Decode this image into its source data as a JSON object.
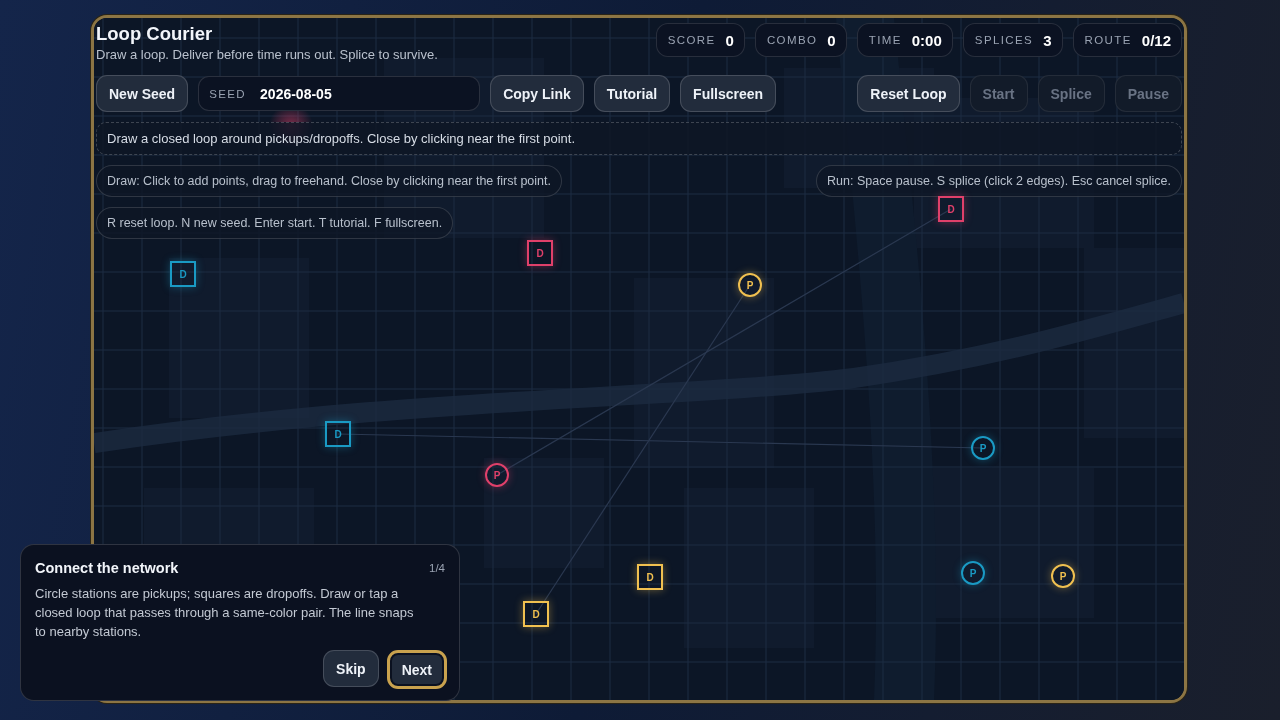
{
  "header": {
    "title": "Loop Courier",
    "subtitle": "Draw a loop. Deliver before time runs out. Splice to survive."
  },
  "stats": [
    {
      "label": "SCORE",
      "value": "0"
    },
    {
      "label": "COMBO",
      "value": "0"
    },
    {
      "label": "TIME",
      "value": "0:00"
    },
    {
      "label": "SPLICES",
      "value": "3"
    },
    {
      "label": "ROUTE",
      "value": "0/12"
    }
  ],
  "toolbar_left": [
    {
      "kind": "button",
      "label": "New Seed",
      "disabled": false
    },
    {
      "kind": "field",
      "label": "SEED",
      "value": "2026-08-05"
    },
    {
      "kind": "button",
      "label": "Copy Link",
      "disabled": false
    },
    {
      "kind": "button",
      "label": "Tutorial",
      "disabled": false
    },
    {
      "kind": "button",
      "label": "Fullscreen",
      "disabled": false
    }
  ],
  "toolbar_right": [
    {
      "label": "Reset Loop",
      "disabled": false
    },
    {
      "label": "Start",
      "disabled": true
    },
    {
      "label": "Splice",
      "disabled": true
    },
    {
      "label": "Pause",
      "disabled": true
    }
  ],
  "banner": "Draw a closed loop around pickups/dropoffs. Close by clicking near the first point.",
  "hints_left": [
    "Draw: Click to add points, drag to freehand. Close by clicking near the first point.",
    "R reset loop. N new seed. Enter start. T tutorial. F fullscreen."
  ],
  "hints_right": [
    "Run: Space pause. S splice (click 2 edges). Esc cancel splice."
  ],
  "stations": [
    {
      "kind": "dropoff",
      "label": "D",
      "color": "#1a9ac4"
    },
    {
      "kind": "dropoff",
      "label": "D",
      "color": "#e0406a"
    },
    {
      "kind": "dropoff",
      "label": "D",
      "color": "#e0406a"
    },
    {
      "kind": "pickup",
      "label": "P",
      "color": "#f0c050"
    },
    {
      "kind": "dropoff",
      "label": "D",
      "color": "#1a9ac4"
    },
    {
      "kind": "pickup",
      "label": "P",
      "color": "#e0406a"
    },
    {
      "kind": "pickup",
      "label": "P",
      "color": "#1a9ac4"
    },
    {
      "kind": "dropoff",
      "label": "D",
      "color": "#f0c050"
    },
    {
      "kind": "dropoff",
      "label": "D",
      "color": "#f0c050"
    },
    {
      "kind": "pickup",
      "label": "P",
      "color": "#1a9ac4"
    },
    {
      "kind": "pickup",
      "label": "P",
      "color": "#f0c050"
    }
  ],
  "tutorial": {
    "title": "Connect the network",
    "step": "1/4",
    "body": "Circle stations are pickups; squares are dropoffs. Draw or tap a closed loop that passes through a same-color pair. The line snaps to nearby stations.",
    "buttons": [
      {
        "label": "Skip",
        "focused": false
      },
      {
        "label": "Next",
        "focused": true
      }
    ]
  }
}
